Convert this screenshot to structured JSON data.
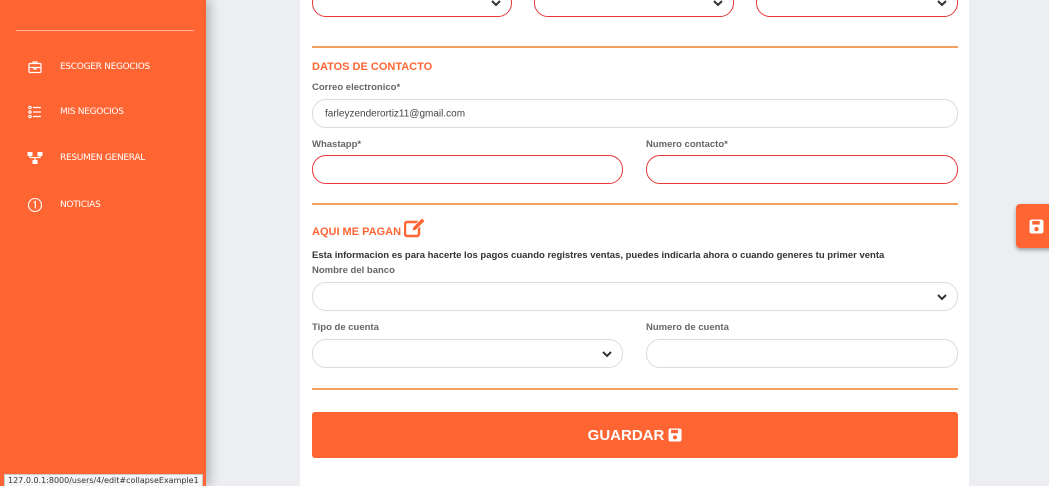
{
  "sidebar": {
    "items": [
      {
        "label": "ESCOGER NEGOCIOS",
        "icon": "briefcase-icon"
      },
      {
        "label": "MIS NEGOCIOS",
        "icon": "list-icon"
      },
      {
        "label": "RESUMEN GENERAL",
        "icon": "sitemap-icon"
      },
      {
        "label": "NOTICIAS",
        "icon": "info-icon"
      }
    ]
  },
  "status_bar": {
    "url": "127.0.0.1:8000/users/4/edit#collapseExample1"
  },
  "contact": {
    "title": "DATOS DE CONTACTO",
    "email_label": "Correo electronico*",
    "email_value": "farleyzenderortiz11@gmail.com",
    "whatsapp_label": "Whastapp*",
    "whatsapp_value": "",
    "phone_label": "Numero contacto*",
    "phone_value": ""
  },
  "payment": {
    "title": "AQUI ME PAGAN",
    "title_icon": "edit-icon",
    "description": "Esta informacion es para hacerte los pagos cuando registres ventas, puedes indicarla ahora o cuando generes tu primer venta",
    "bank_label": "Nombre del banco",
    "bank_value": "",
    "account_type_label": "Tipo de cuenta",
    "account_type_value": "",
    "account_number_label": "Numero de cuenta",
    "account_number_value": ""
  },
  "save_button": {
    "label": "GUARDAR",
    "icon": "save-icon"
  },
  "colors": {
    "accent": "#ff6533",
    "error_border": "#e8383b",
    "divider": "#f3a060"
  }
}
